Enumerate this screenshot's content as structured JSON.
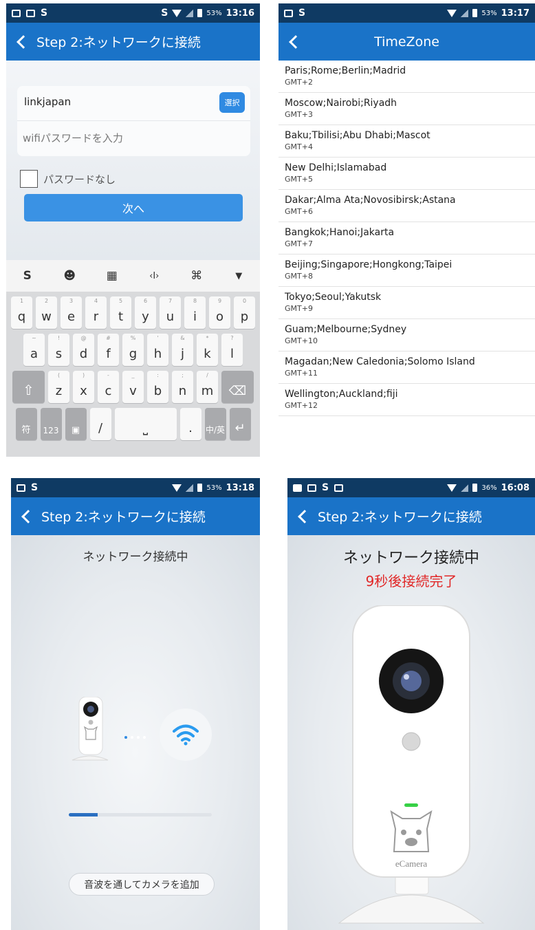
{
  "phone1": {
    "status": {
      "time": "13:16",
      "battery": "53%"
    },
    "title": "Step 2:ネットワークに接続",
    "ssid": "linkjapan",
    "select_label": "選択",
    "password_placeholder": "wifiパスワードを入力",
    "no_password_label": "パスワードなし",
    "next_label": "次へ",
    "keyboard_rows": [
      [
        {
          "k": "q",
          "h": "1"
        },
        {
          "k": "w",
          "h": "2"
        },
        {
          "k": "e",
          "h": "3"
        },
        {
          "k": "r",
          "h": "4"
        },
        {
          "k": "t",
          "h": "5"
        },
        {
          "k": "y",
          "h": "6"
        },
        {
          "k": "u",
          "h": "7"
        },
        {
          "k": "i",
          "h": "8"
        },
        {
          "k": "o",
          "h": "9"
        },
        {
          "k": "p",
          "h": "0"
        }
      ],
      [
        {
          "k": "a",
          "h": "~"
        },
        {
          "k": "s",
          "h": "!"
        },
        {
          "k": "d",
          "h": "@"
        },
        {
          "k": "f",
          "h": "#"
        },
        {
          "k": "g",
          "h": "%"
        },
        {
          "k": "h",
          "h": "'"
        },
        {
          "k": "j",
          "h": "&"
        },
        {
          "k": "k",
          "h": "*"
        },
        {
          "k": "l",
          "h": "?"
        }
      ],
      [
        {
          "k": "z",
          "h": "("
        },
        {
          "k": "x",
          "h": ")"
        },
        {
          "k": "c",
          "h": "-"
        },
        {
          "k": "v",
          "h": "_"
        },
        {
          "k": "b",
          "h": ":"
        },
        {
          "k": "n",
          "h": ";"
        },
        {
          "k": "m",
          "h": "/"
        }
      ]
    ],
    "kbd_bottom": {
      "sym": "符",
      "num": "123",
      "slash": "/",
      "dot": ".",
      "lang": "中/英"
    }
  },
  "phone2": {
    "status": {
      "time": "13:17",
      "battery": "53%"
    },
    "title": "TimeZone",
    "timezones": [
      {
        "city": "Paris;Rome;Berlin;Madrid",
        "gmt": "GMT+2"
      },
      {
        "city": "Moscow;Nairobi;Riyadh",
        "gmt": "GMT+3"
      },
      {
        "city": "Baku;Tbilisi;Abu Dhabi;Mascot",
        "gmt": "GMT+4"
      },
      {
        "city": "New Delhi;Islamabad",
        "gmt": "GMT+5"
      },
      {
        "city": "Dakar;Alma Ata;Novosibirsk;Astana",
        "gmt": "GMT+6"
      },
      {
        "city": "Bangkok;Hanoi;Jakarta",
        "gmt": "GMT+7"
      },
      {
        "city": "Beijing;Singapore;Hongkong;Taipei",
        "gmt": "GMT+8"
      },
      {
        "city": "Tokyo;Seoul;Yakutsk",
        "gmt": "GMT+9"
      },
      {
        "city": "Guam;Melbourne;Sydney",
        "gmt": "GMT+10"
      },
      {
        "city": "Magadan;New Caledonia;Solomo Island",
        "gmt": "GMT+11"
      },
      {
        "city": "Wellington;Auckland;fiji",
        "gmt": "GMT+12"
      }
    ]
  },
  "phone3": {
    "status": {
      "time": "13:18",
      "battery": "53%"
    },
    "title": "Step 2:ネットワークに接続",
    "connecting": "ネットワーク接続中",
    "progress": 0.2,
    "sonic_button": "音波を通してカメラを追加"
  },
  "phone4": {
    "status": {
      "time": "16:08",
      "battery": "36%"
    },
    "title": "Step 2:ネットワークに接続",
    "connecting": "ネットワーク接続中",
    "countdown": "9秒後接続完了",
    "brand": "eCamera"
  },
  "colors": {
    "statusbar": "#0f3a63",
    "titlebar": "#1a73c8",
    "accent": "#2f8ae2",
    "countdown": "#e12828"
  }
}
